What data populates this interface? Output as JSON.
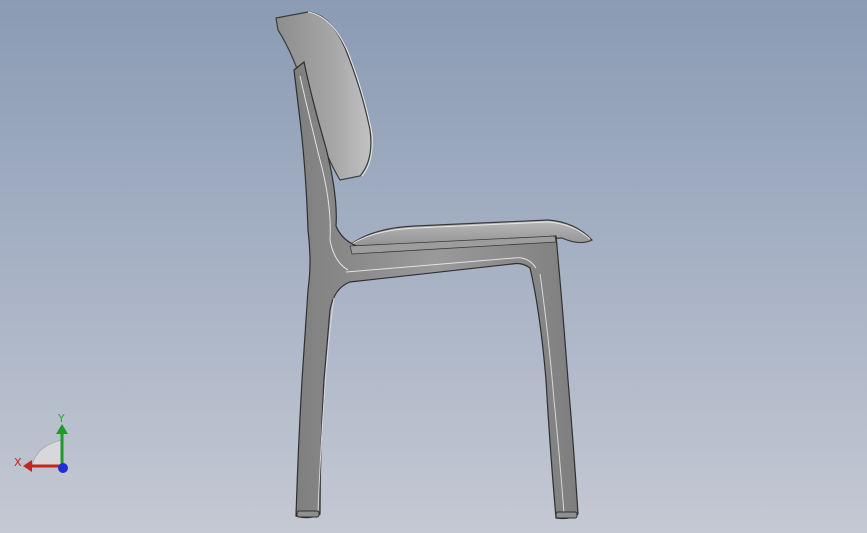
{
  "viewport": {
    "model": "chair-side-view",
    "background_top": "#8a9bb4",
    "background_bottom": "#c4c9d3"
  },
  "triad": {
    "x_label": "X",
    "y_label": "Y",
    "x_color": "#c0281e",
    "y_color": "#1f9a2a",
    "z_color": "#1d2fd6"
  }
}
